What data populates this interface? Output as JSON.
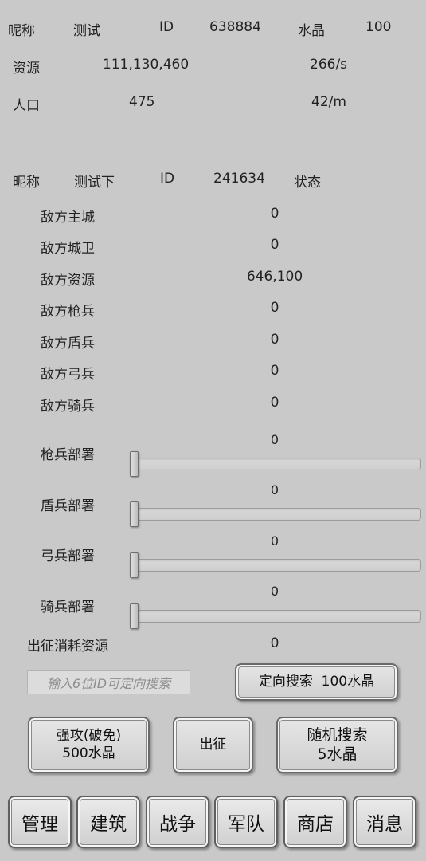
{
  "player": {
    "nickname_label": "昵称",
    "nickname": "测试",
    "id_label": "ID",
    "id": "638884",
    "crystal_label": "水晶",
    "crystal": "100",
    "resource_label": "资源",
    "resource": "111,130,460",
    "resource_rate": "266/s",
    "population_label": "人口",
    "population": "475",
    "population_rate": "42/m"
  },
  "target": {
    "nickname_label": "昵称",
    "nickname": "测试下",
    "id_label": "ID",
    "id": "241634",
    "status_label": "状态",
    "stats": [
      {
        "label": "敌方主城",
        "value": "0"
      },
      {
        "label": "敌方城卫",
        "value": "0"
      },
      {
        "label": "敌方资源",
        "value": "646,100"
      },
      {
        "label": "敌方枪兵",
        "value": "0"
      },
      {
        "label": "敌方盾兵",
        "value": "0"
      },
      {
        "label": "敌方弓兵",
        "value": "0"
      },
      {
        "label": "敌方骑兵",
        "value": "0"
      }
    ]
  },
  "deploy": [
    {
      "label": "枪兵部署",
      "value": "0",
      "level": 0
    },
    {
      "label": "盾兵部署",
      "value": "0",
      "level": 0
    },
    {
      "label": "弓兵部署",
      "value": "0",
      "level": 0
    },
    {
      "label": "骑兵部署",
      "value": "0",
      "level": 0
    }
  ],
  "cost": {
    "label": "出征消耗资源",
    "value": "0"
  },
  "search": {
    "placeholder": "输入6位ID可定向搜索",
    "directed_button": "定向搜索  100水晶"
  },
  "actions": {
    "strong_attack_line1": "强攻(破免)",
    "strong_attack_line2": "500水晶",
    "march": "出征",
    "random_search_line1": "随机搜索",
    "random_search_line2": "5水晶"
  },
  "tabs": [
    "管理",
    "建筑",
    "战争",
    "军队",
    "商店",
    "消息"
  ]
}
